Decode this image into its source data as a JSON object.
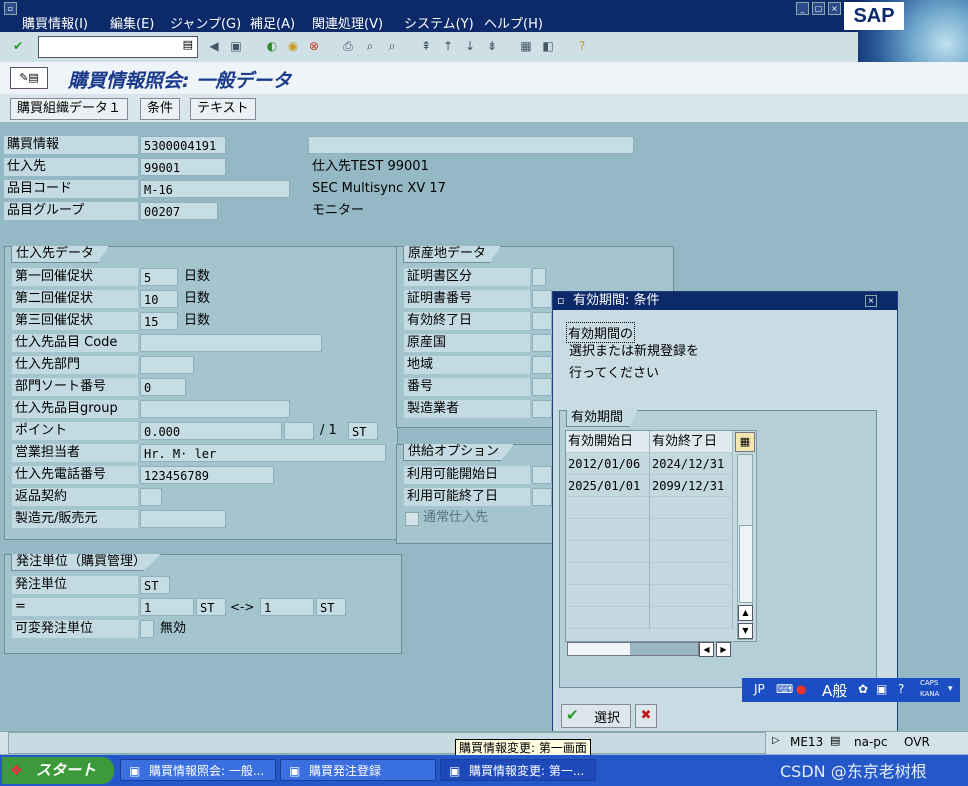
{
  "menu": [
    "購買情報(I)",
    "編集(E)",
    "ジャンプ(G)",
    "補足(A)",
    "関連処理(V)",
    "システム(Y)",
    "ヘルプ(H)"
  ],
  "logo": "SAP",
  "page_title": "購買情報照会: 一般データ",
  "tabs": [
    "購買組織データ１",
    "条件",
    "テキスト"
  ],
  "header": {
    "rows": [
      {
        "label": "購買情報",
        "value": "5300004191",
        "desc": ""
      },
      {
        "label": "仕入先",
        "value": "99001",
        "desc": "仕入先TEST 99001"
      },
      {
        "label": "品目コード",
        "value": "M-16",
        "desc": "SEC Multisync XV 17"
      },
      {
        "label": "品目グループ",
        "value": "00207",
        "desc": "モニター"
      }
    ]
  },
  "vendor_group": {
    "title": "仕入先データ",
    "rows": [
      {
        "label": "第一回催促状",
        "value": "5",
        "unit": "日数"
      },
      {
        "label": "第二回催促状",
        "value": "10",
        "unit": "日数"
      },
      {
        "label": "第三回催促状",
        "value": "15",
        "unit": "日数"
      },
      {
        "label": "仕入先品目 Code",
        "value": ""
      },
      {
        "label": "仕入先部門",
        "value": ""
      },
      {
        "label": "部門ソート番号",
        "value": "0"
      },
      {
        "label": "仕入先品目group",
        "value": ""
      },
      {
        "label": "ポイント",
        "value": "0.000",
        "sep": "/ 1",
        "unit2": "ST"
      },
      {
        "label": "営業担当者",
        "value": "Hr. M· ler"
      },
      {
        "label": "仕入先電話番号",
        "value": "123456789"
      },
      {
        "label": "返品契約",
        "value": ""
      },
      {
        "label": "製造元/販売元",
        "value": ""
      }
    ]
  },
  "origin_group": {
    "title": "原産地データ",
    "rows": [
      "証明書区分",
      "証明書番号",
      "有効終了日",
      "原産国",
      "地域",
      "番号",
      "製造業者"
    ]
  },
  "supply_group": {
    "title": "供給オプション",
    "rows": [
      "利用可能開始日",
      "利用可能終了日"
    ],
    "checkbox": "通常仕入先"
  },
  "order_group": {
    "title": "発注単位（購買管理）",
    "unit_label": "発注単位",
    "unit_value": "ST",
    "eq_label": "=",
    "eq_left_value": "1",
    "eq_left_unit": "ST",
    "arrow": "<->",
    "eq_right_value": "1",
    "eq_right_unit": "ST",
    "variable_label": "可変発注単位",
    "variable_text": "無効"
  },
  "popup": {
    "title": "有効期間: 条件",
    "heading": "有効期間の",
    "line1": "選択または新規登録を",
    "line2": "行ってください",
    "group_title": "有効期間",
    "columns": [
      "有効開始日",
      "有効終了日"
    ],
    "rows": [
      [
        "2012/01/06",
        "2024/12/31"
      ],
      [
        "2025/01/01",
        "2099/12/31"
      ]
    ],
    "select_label": "選択"
  },
  "ime": {
    "lang": "JP",
    "mode": "A般",
    "caps": "CAPS",
    "kana": "KANA"
  },
  "status": {
    "tooltip": "購買情報変更: 第一画面",
    "tcode": "ME13",
    "server": "na-pc",
    "mode": "OVR"
  },
  "taskbar": {
    "start": "スタート",
    "tasks": [
      "購買情報照会: 一般...",
      "購買発注登録",
      "購買情報変更: 第一..."
    ]
  },
  "watermark": "CSDN @东京老树根",
  "colors": {
    "menubar": "#0c2a6a",
    "background": "#94b8c4",
    "title": "#1b3a8a"
  }
}
